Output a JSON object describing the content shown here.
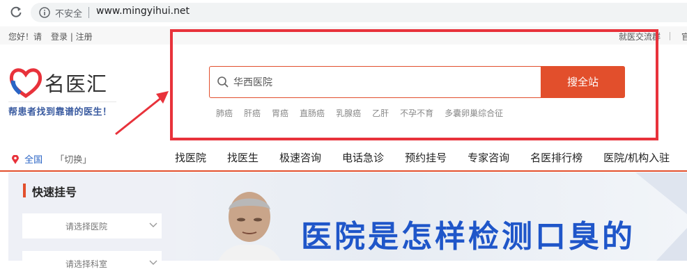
{
  "browser": {
    "security_label": "不安全",
    "url": "www.mingyihui.net"
  },
  "topbar": {
    "greeting": "您好！请",
    "login_register": "登录 | 注册",
    "right_link": "就医交流群",
    "right_link2": "官"
  },
  "logo": {
    "name": "名医汇",
    "slogan": "帮患者找到靠谱的医生！"
  },
  "search": {
    "value": "华西医院",
    "button_label": "搜全站",
    "hot_terms": [
      "肺癌",
      "肝癌",
      "胃癌",
      "直肠癌",
      "乳腺癌",
      "乙肝",
      "不孕不育",
      "多囊卵巢综合征"
    ]
  },
  "location": {
    "city": "全国",
    "switch_label": "「切换」"
  },
  "nav": {
    "items": [
      "找医院",
      "找医生",
      "极速咨询",
      "电话急诊",
      "预约挂号",
      "专家咨询",
      "名医排行榜",
      "医院/机构入驻"
    ]
  },
  "quick_register": {
    "title": "快速挂号",
    "hospital_select": "请选择医院",
    "department_select": "请选择科室"
  },
  "banner": {
    "headline": "医院是怎样检测口臭的"
  },
  "colors": {
    "accent": "#e24f2c",
    "annotation": "#e8323b",
    "brand_blue": "#2a64c5",
    "headline_blue": "#1f56c9"
  }
}
